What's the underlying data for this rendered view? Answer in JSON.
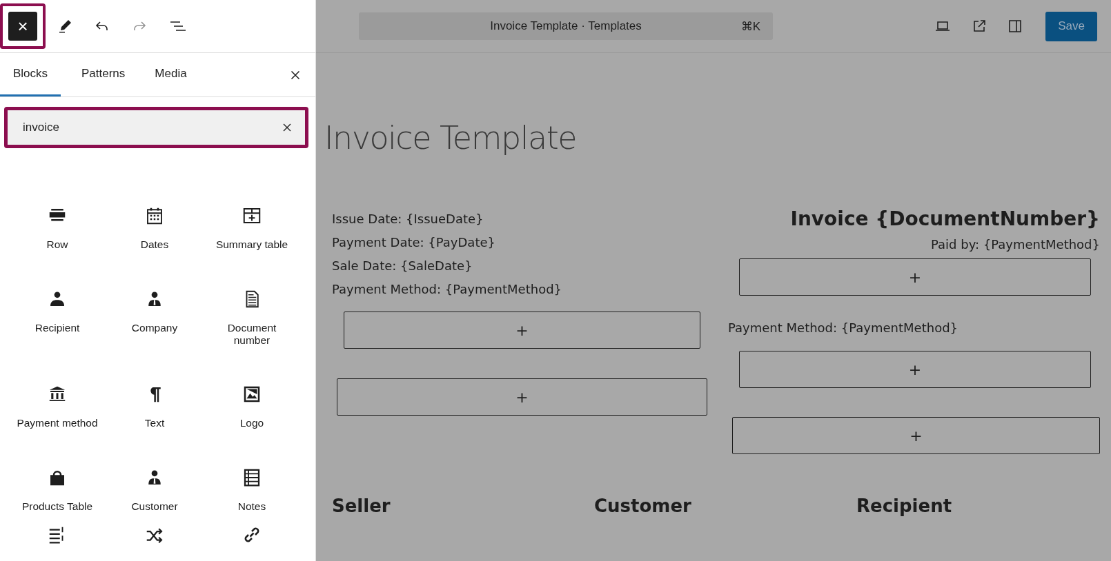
{
  "toolbar": {
    "inserter_toggle": {
      "label": "×",
      "pressed": true,
      "highlighted": true
    },
    "redo_disabled": true
  },
  "command_bar": {
    "title": "Invoice Template · Templates",
    "shortcut": "⌘K"
  },
  "save_button": "Save",
  "tabs": [
    {
      "label": "Blocks",
      "selected": true
    },
    {
      "label": "Patterns",
      "selected": false
    },
    {
      "label": "Media",
      "selected": false
    }
  ],
  "search": {
    "value": "invoice",
    "highlighted": true
  },
  "blocks": [
    {
      "label": "Row",
      "kind": "row"
    },
    {
      "label": "Dates",
      "kind": "calendar"
    },
    {
      "label": "Summary table",
      "kind": "table"
    },
    {
      "label": "Recipient",
      "kind": "person"
    },
    {
      "label": "Company",
      "kind": "person-tie"
    },
    {
      "label": "Document number",
      "kind": "document"
    },
    {
      "label": "Payment method",
      "kind": "bank"
    },
    {
      "label": "Text",
      "kind": "paragraph"
    },
    {
      "label": "Logo",
      "kind": "image"
    },
    {
      "label": "Products Table",
      "kind": "bag"
    },
    {
      "label": "Customer",
      "kind": "person-tie"
    },
    {
      "label": "Notes",
      "kind": "list"
    },
    {
      "kind": "numbered-list"
    },
    {
      "kind": "shuffle"
    },
    {
      "kind": "link"
    }
  ],
  "canvas": {
    "title": "Invoice Template",
    "left": [
      {
        "kind": "text",
        "text": "Issue Date: {IssueDate}"
      },
      {
        "kind": "text",
        "text": "Payment Date: {PayDate}"
      },
      {
        "kind": "text",
        "text": "Sale Date: {SaleDate}"
      },
      {
        "kind": "text",
        "text": "Payment Method: {PaymentMethod}"
      },
      {
        "kind": "appender",
        "text": "+"
      },
      {
        "kind": "appender",
        "text": "+"
      }
    ],
    "right": [
      {
        "kind": "heading",
        "text": "Invoice {DocumentNumber}"
      },
      {
        "kind": "note",
        "text": "Paid by: {PaymentMethod}"
      },
      {
        "kind": "appender",
        "text": "+"
      },
      {
        "kind": "text",
        "text": "Payment Method: {PaymentMethod}"
      },
      {
        "kind": "appender",
        "text": "+"
      },
      {
        "kind": "appender",
        "text": "+"
      }
    ],
    "sections": [
      "Seller",
      "Customer",
      "Recipient"
    ]
  }
}
